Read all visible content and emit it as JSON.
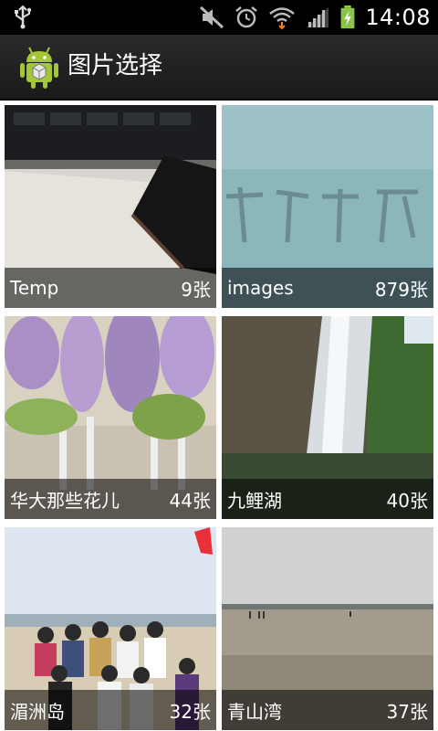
{
  "status_bar": {
    "time": "14:08"
  },
  "action_bar": {
    "title": "图片选择"
  },
  "albums": [
    {
      "name": "Temp",
      "count": "9张"
    },
    {
      "name": "images",
      "count": "879张"
    },
    {
      "name": "华大那些花儿",
      "count": "44张"
    },
    {
      "name": "九鲤湖",
      "count": "40张"
    },
    {
      "name": "湄洲岛",
      "count": "32张"
    },
    {
      "name": "青山湾",
      "count": "37张"
    }
  ]
}
